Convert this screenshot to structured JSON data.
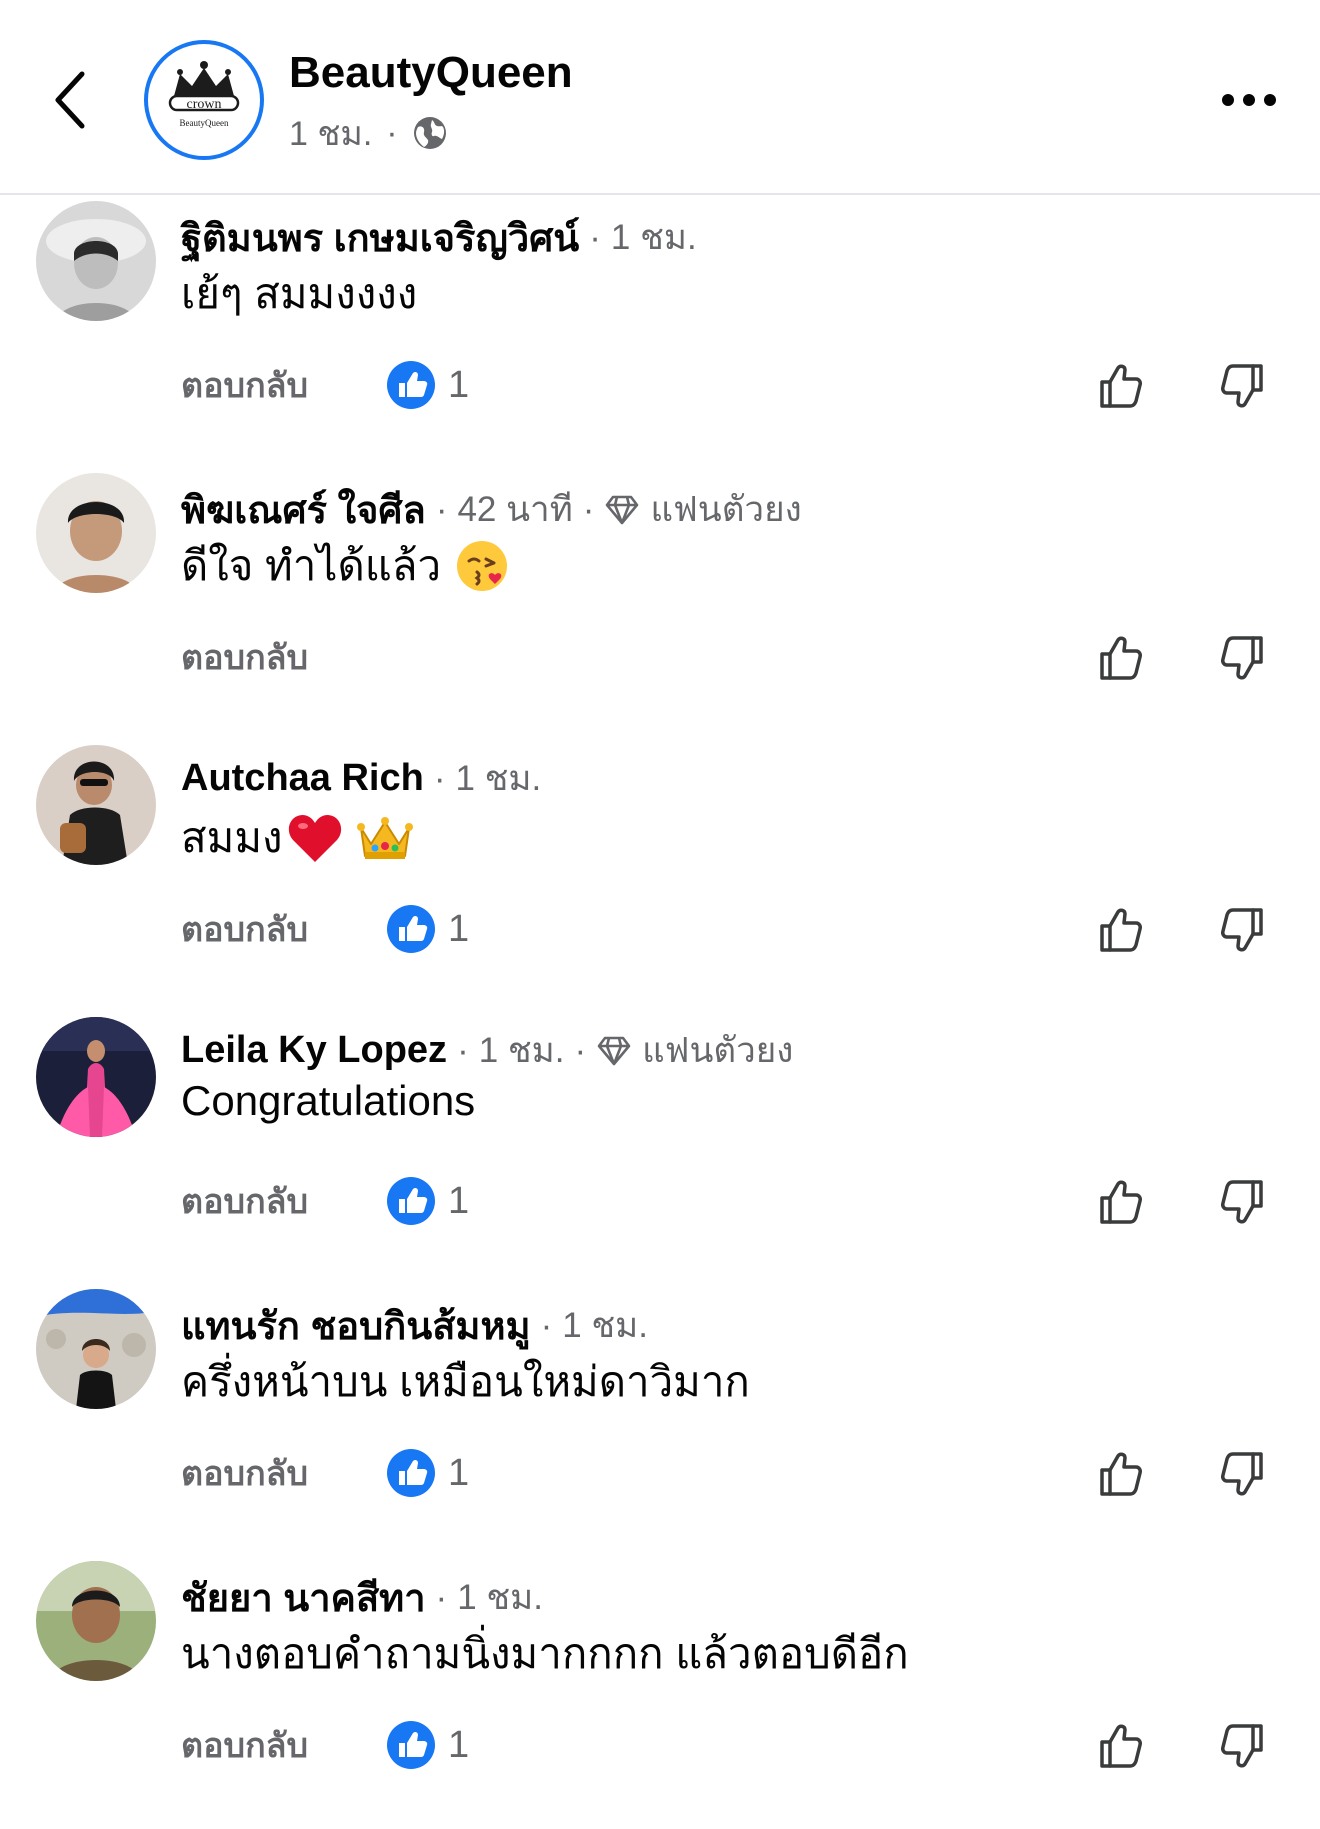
{
  "header": {
    "page_name": "BeautyQueen",
    "time": "1 ชม.",
    "dot": "·",
    "avatar_logo_text": "crown",
    "avatar_logo_subtext": "BeautyQueen",
    "icons": {
      "back": "chevron-left-icon",
      "privacy": "globe-icon",
      "more": "more-horizontal-icon"
    }
  },
  "comments": [
    {
      "name": "ฐิติมนพร เกษมเจริญวิศน์",
      "sep": "·",
      "time": "1 ชม.",
      "text": "เย้ๆ สมมงงงง",
      "reply": "ตอบกลับ",
      "reaction_count": "1"
    },
    {
      "name": "พิฆเณศร์ ใจศีล",
      "sep": "·",
      "time": "42 นาที",
      "badge": "แฟนตัวยง",
      "text": "ดีใจ ทำได้แล้ว",
      "emoji": "face-blowing-kiss-emoji",
      "reply": "ตอบกลับ"
    },
    {
      "name": "Autchaa Rich",
      "sep": "·",
      "time": "1 ชม.",
      "text": "สมมง",
      "emoji": "red-heart-emoji, crown-emoji",
      "reply": "ตอบกลับ",
      "reaction_count": "1"
    },
    {
      "name": "Leila Ky Lopez",
      "sep": "·",
      "time": "1 ชม.",
      "badge": "แฟนตัวยง",
      "text": "Congratulations",
      "reply": "ตอบกลับ",
      "reaction_count": "1"
    },
    {
      "name": "แทนรัก ชอบกินส้มหมู",
      "sep": "·",
      "time": "1 ชม.",
      "text": "ครึ่งหน้าบน เหมือนใหม่ดาวิมาก",
      "reply": "ตอบกลับ",
      "reaction_count": "1"
    },
    {
      "name": "ชัยยา นาคสีทา",
      "sep": "·",
      "time": "1 ชม.",
      "text": "นางตอบคำถามนิ่งมากกกก แล้วตอบดีอีก",
      "reply": "ตอบกลับ",
      "reaction_count": "1"
    }
  ],
  "colors": {
    "accent_blue": "#1877f2",
    "secondary_text": "#65676b",
    "primary_text": "#050505",
    "divider": "#e4e6eb"
  }
}
